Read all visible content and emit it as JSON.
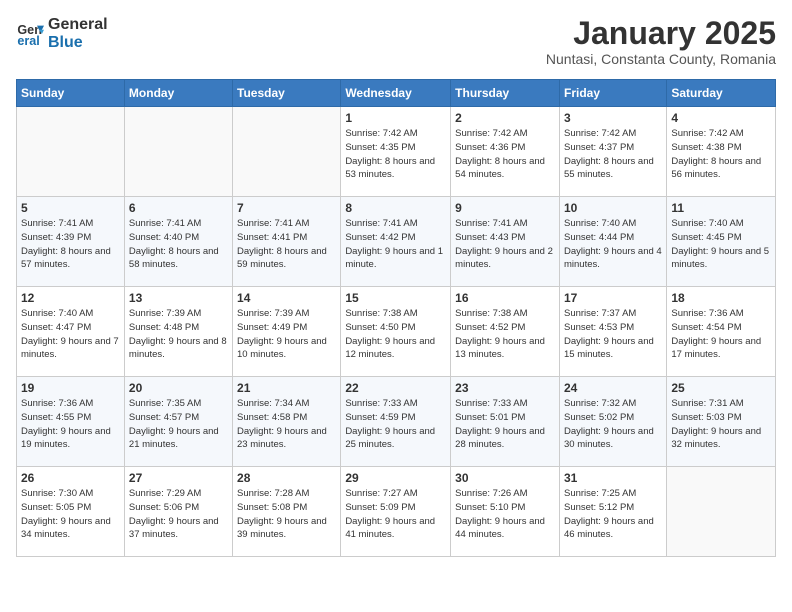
{
  "header": {
    "logo_general": "General",
    "logo_blue": "Blue",
    "title": "January 2025",
    "subtitle": "Nuntasi, Constanta County, Romania"
  },
  "weekdays": [
    "Sunday",
    "Monday",
    "Tuesday",
    "Wednesday",
    "Thursday",
    "Friday",
    "Saturday"
  ],
  "weeks": [
    [
      {
        "day": "",
        "info": ""
      },
      {
        "day": "",
        "info": ""
      },
      {
        "day": "",
        "info": ""
      },
      {
        "day": "1",
        "info": "Sunrise: 7:42 AM\nSunset: 4:35 PM\nDaylight: 8 hours and 53 minutes."
      },
      {
        "day": "2",
        "info": "Sunrise: 7:42 AM\nSunset: 4:36 PM\nDaylight: 8 hours and 54 minutes."
      },
      {
        "day": "3",
        "info": "Sunrise: 7:42 AM\nSunset: 4:37 PM\nDaylight: 8 hours and 55 minutes."
      },
      {
        "day": "4",
        "info": "Sunrise: 7:42 AM\nSunset: 4:38 PM\nDaylight: 8 hours and 56 minutes."
      }
    ],
    [
      {
        "day": "5",
        "info": "Sunrise: 7:41 AM\nSunset: 4:39 PM\nDaylight: 8 hours and 57 minutes."
      },
      {
        "day": "6",
        "info": "Sunrise: 7:41 AM\nSunset: 4:40 PM\nDaylight: 8 hours and 58 minutes."
      },
      {
        "day": "7",
        "info": "Sunrise: 7:41 AM\nSunset: 4:41 PM\nDaylight: 8 hours and 59 minutes."
      },
      {
        "day": "8",
        "info": "Sunrise: 7:41 AM\nSunset: 4:42 PM\nDaylight: 9 hours and 1 minute."
      },
      {
        "day": "9",
        "info": "Sunrise: 7:41 AM\nSunset: 4:43 PM\nDaylight: 9 hours and 2 minutes."
      },
      {
        "day": "10",
        "info": "Sunrise: 7:40 AM\nSunset: 4:44 PM\nDaylight: 9 hours and 4 minutes."
      },
      {
        "day": "11",
        "info": "Sunrise: 7:40 AM\nSunset: 4:45 PM\nDaylight: 9 hours and 5 minutes."
      }
    ],
    [
      {
        "day": "12",
        "info": "Sunrise: 7:40 AM\nSunset: 4:47 PM\nDaylight: 9 hours and 7 minutes."
      },
      {
        "day": "13",
        "info": "Sunrise: 7:39 AM\nSunset: 4:48 PM\nDaylight: 9 hours and 8 minutes."
      },
      {
        "day": "14",
        "info": "Sunrise: 7:39 AM\nSunset: 4:49 PM\nDaylight: 9 hours and 10 minutes."
      },
      {
        "day": "15",
        "info": "Sunrise: 7:38 AM\nSunset: 4:50 PM\nDaylight: 9 hours and 12 minutes."
      },
      {
        "day": "16",
        "info": "Sunrise: 7:38 AM\nSunset: 4:52 PM\nDaylight: 9 hours and 13 minutes."
      },
      {
        "day": "17",
        "info": "Sunrise: 7:37 AM\nSunset: 4:53 PM\nDaylight: 9 hours and 15 minutes."
      },
      {
        "day": "18",
        "info": "Sunrise: 7:36 AM\nSunset: 4:54 PM\nDaylight: 9 hours and 17 minutes."
      }
    ],
    [
      {
        "day": "19",
        "info": "Sunrise: 7:36 AM\nSunset: 4:55 PM\nDaylight: 9 hours and 19 minutes."
      },
      {
        "day": "20",
        "info": "Sunrise: 7:35 AM\nSunset: 4:57 PM\nDaylight: 9 hours and 21 minutes."
      },
      {
        "day": "21",
        "info": "Sunrise: 7:34 AM\nSunset: 4:58 PM\nDaylight: 9 hours and 23 minutes."
      },
      {
        "day": "22",
        "info": "Sunrise: 7:33 AM\nSunset: 4:59 PM\nDaylight: 9 hours and 25 minutes."
      },
      {
        "day": "23",
        "info": "Sunrise: 7:33 AM\nSunset: 5:01 PM\nDaylight: 9 hours and 28 minutes."
      },
      {
        "day": "24",
        "info": "Sunrise: 7:32 AM\nSunset: 5:02 PM\nDaylight: 9 hours and 30 minutes."
      },
      {
        "day": "25",
        "info": "Sunrise: 7:31 AM\nSunset: 5:03 PM\nDaylight: 9 hours and 32 minutes."
      }
    ],
    [
      {
        "day": "26",
        "info": "Sunrise: 7:30 AM\nSunset: 5:05 PM\nDaylight: 9 hours and 34 minutes."
      },
      {
        "day": "27",
        "info": "Sunrise: 7:29 AM\nSunset: 5:06 PM\nDaylight: 9 hours and 37 minutes."
      },
      {
        "day": "28",
        "info": "Sunrise: 7:28 AM\nSunset: 5:08 PM\nDaylight: 9 hours and 39 minutes."
      },
      {
        "day": "29",
        "info": "Sunrise: 7:27 AM\nSunset: 5:09 PM\nDaylight: 9 hours and 41 minutes."
      },
      {
        "day": "30",
        "info": "Sunrise: 7:26 AM\nSunset: 5:10 PM\nDaylight: 9 hours and 44 minutes."
      },
      {
        "day": "31",
        "info": "Sunrise: 7:25 AM\nSunset: 5:12 PM\nDaylight: 9 hours and 46 minutes."
      },
      {
        "day": "",
        "info": ""
      }
    ]
  ]
}
